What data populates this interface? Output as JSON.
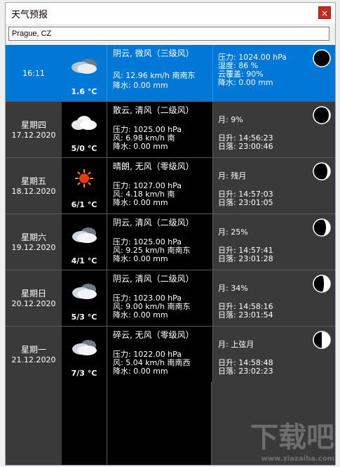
{
  "window": {
    "title": "天气预报",
    "close_glyph": "×"
  },
  "search": {
    "city": "Prague, CZ",
    "placeholder": ""
  },
  "current": {
    "time": "16:11",
    "temp": "1.6 °C",
    "condition": "阴云, 微风（三级风）",
    "wind": "风: 12.96 km/h 南南东",
    "precip": "降水: 0.00 mm",
    "pressure": "压力: 1024.00 hPa",
    "humidity": "湿度: 86 %",
    "cloud": "云覆盖: 90%",
    "precip2": "降水: 0.00 mm",
    "moon_icon": "moon-new-icon"
  },
  "forecast": [
    {
      "day": "星期四",
      "date": "17.12.2020",
      "temp": "5/0 °C",
      "icon": "cloudy-icon",
      "condition": "散云, 清风（二级风）",
      "pressure": "压力: 1025.00 hPa",
      "wind": "风: 6.98 km/h 南",
      "precip": "降水: 0.00 mm",
      "moon": "月: 9%",
      "rise": "日升: 14:56:23",
      "set": "日落: 23:00:46",
      "moon_fill": 0.09
    },
    {
      "day": "星期五",
      "date": "18.12.2020",
      "temp": "6/1 °C",
      "icon": "sun-icon",
      "condition": "晴朗, 无风（零级风）",
      "pressure": "压力: 1027.00 hPa",
      "wind": "风: 4.18 km/h 南",
      "precip": "降水: 0.00 mm",
      "moon": "月: 残月",
      "rise": "日升: 14:57:03",
      "set": "日落: 23:01:05",
      "moon_fill": 0.16
    },
    {
      "day": "星期六",
      "date": "19.12.2020",
      "temp": "4/1 °C",
      "icon": "partly-cloudy-icon",
      "condition": "阴云, 清风（二级风）",
      "pressure": "压力: 1025.00 hPa",
      "wind": "风: 9.25 km/h 南南东",
      "precip": "降水: 0.00 mm",
      "moon": "月: 25%",
      "rise": "日升: 14:57:41",
      "set": "日落: 23:01:28",
      "moon_fill": 0.25
    },
    {
      "day": "星期日",
      "date": "20.12.2020",
      "temp": "5/3 °C",
      "icon": "partly-cloudy-icon",
      "condition": "阴云, 清风（二级风）",
      "pressure": "压力: 1023.00 hPa",
      "wind": "风: 9.00 km/h 南南东",
      "precip": "降水: 0.00 mm",
      "moon": "月: 34%",
      "rise": "日升: 14:58:16",
      "set": "日落: 23:01:54",
      "moon_fill": 0.34
    },
    {
      "day": "星期一",
      "date": "21.12.2020",
      "temp": "7/3 °C",
      "icon": "partly-cloudy-icon",
      "condition": "碎云, 无风（零级风）",
      "pressure": "压力: 1022.00 hPa",
      "wind": "风: 5.04 km/h 南南西",
      "precip": "降水: 0.00 mm",
      "moon": "月: 上弦月",
      "rise": "日升: 14:58:48",
      "set": "日落: 23:02:23",
      "moon_fill": 0.5
    }
  ],
  "colors": {
    "accent": "#0078d7",
    "panel": "#3a3a3a",
    "black": "#000000",
    "sun": "#e23b10"
  },
  "watermark": {
    "text": "下载吧",
    "sub": "www.xiazaiba.com"
  }
}
